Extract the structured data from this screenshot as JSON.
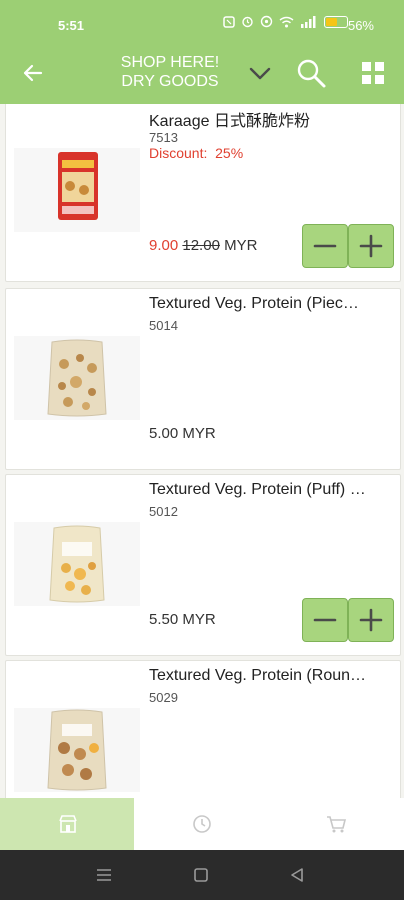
{
  "status_bar": {
    "time": "5:51",
    "battery": "56%",
    "icons": [
      "nfc-icon",
      "alarm-icon",
      "whatsapp-icon",
      "wifi-icon",
      "signal-icon",
      "battery-icon"
    ]
  },
  "header": {
    "title_line1": "SHOP HERE!",
    "title_line2": "DRY GOODS",
    "icons": [
      "back-arrow-icon",
      "chevron-down-icon",
      "search-icon",
      "grid-view-icon"
    ]
  },
  "products": [
    {
      "name": "Karaage  日式酥脆炸粉",
      "code": "7513",
      "discount_label": "Discount:",
      "discount_value": "25%",
      "price_sale": "9.00",
      "price_old": "12.00",
      "currency": "MYR",
      "has_qty_controls": true
    },
    {
      "name": "Textured Veg. Protein (Piec…",
      "code": "5014",
      "price": "5.00 MYR",
      "has_qty_controls": false
    },
    {
      "name": "Textured Veg. Protein (Puff) …",
      "code": "5012",
      "price": "5.50 MYR",
      "has_qty_controls": true
    },
    {
      "name": "Textured Veg. Protein (Roun…",
      "code": "5029",
      "has_qty_controls": false
    }
  ],
  "bottom_nav": {
    "tabs": [
      {
        "name": "store-icon",
        "active": true
      },
      {
        "name": "history-clock-icon",
        "active": false
      },
      {
        "name": "cart-icon",
        "active": false
      }
    ]
  },
  "colors": {
    "brand_green": "#9ccf74",
    "button_green": "#a8d57e",
    "active_tab": "#cde6b0",
    "sale_red": "#e04030"
  }
}
